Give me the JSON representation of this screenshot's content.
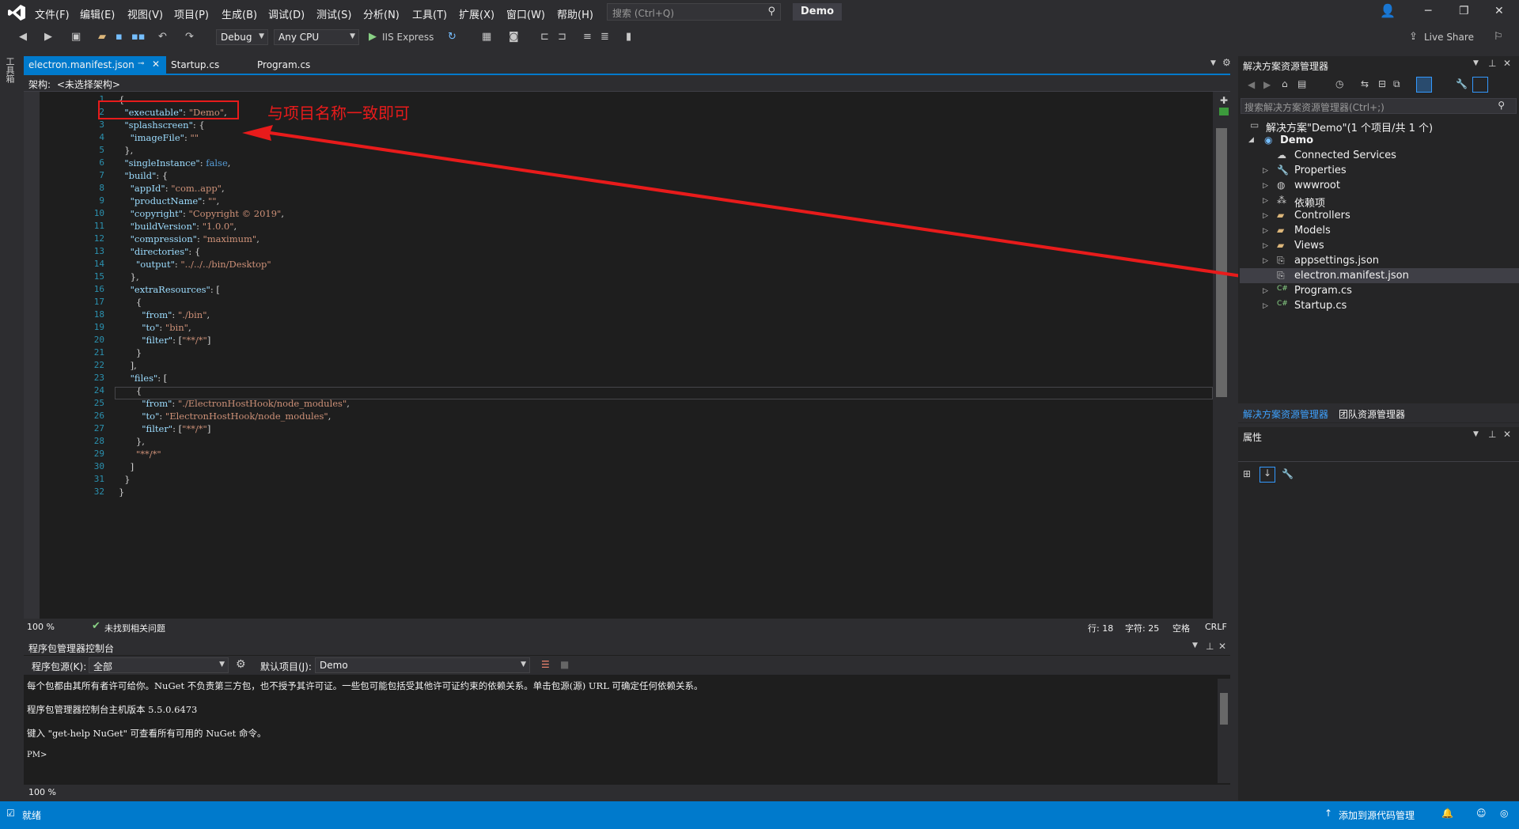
{
  "menu": [
    "文件(F)",
    "编辑(E)",
    "视图(V)",
    "项目(P)",
    "生成(B)",
    "调试(D)",
    "测试(S)",
    "分析(N)",
    "工具(T)",
    "扩展(X)",
    "窗口(W)",
    "帮助(H)"
  ],
  "search": {
    "placeholder": "搜索 (Ctrl+Q)"
  },
  "solution_name": "Demo",
  "toolbar": {
    "config": "Debug",
    "platform": "Any CPU",
    "run": "IIS Express",
    "live_share": "Live Share"
  },
  "toolbox_label": "工具箱",
  "tabs": [
    {
      "label": "electron.manifest.json",
      "active": true
    },
    {
      "label": "Startup.cs",
      "active": false
    },
    {
      "label": "Program.cs",
      "active": false
    }
  ],
  "nav": {
    "label": "架构:",
    "value": "<未选择架构>"
  },
  "code_lines": [
    "{",
    "  \"executable\": \"Demo\",",
    "  \"splashscreen\": {",
    "    \"imageFile\": \"\"",
    "  },",
    "  \"singleInstance\": false,",
    "  \"build\": {",
    "    \"appId\": \"com..app\",",
    "    \"productName\": \"\",",
    "    \"copyright\": \"Copyright © 2019\",",
    "    \"buildVersion\": \"1.0.0\",",
    "    \"compression\": \"maximum\",",
    "    \"directories\": {",
    "      \"output\": \"../../../bin/Desktop\"",
    "    },",
    "    \"extraResources\": [",
    "      {",
    "        \"from\": \"./bin\",",
    "        \"to\": \"bin\",",
    "        \"filter\": [\"**/*\"]",
    "      }",
    "    ],",
    "    \"files\": [",
    "      {",
    "        \"from\": \"./ElectronHostHook/node_modules\",",
    "        \"to\": \"ElectronHostHook/node_modules\",",
    "        \"filter\": [\"**/*\"]",
    "      },",
    "      \"**/*\"",
    "    ]",
    "  }",
    "}"
  ],
  "annotation": "与项目名称一致即可",
  "editor_status": {
    "zoom": "100 %",
    "issues": "未找到相关问题",
    "line": "行: 18",
    "char": "字符: 25",
    "space": "空格",
    "eol": "CRLF"
  },
  "solution_explorer": {
    "title": "解决方案资源管理器",
    "search_placeholder": "搜索解决方案资源管理器(Ctrl+;)",
    "solution_label": "解决方案\"Demo\"(1 个项目/共 1 个)",
    "project": "Demo",
    "items": [
      "Connected Services",
      "Properties",
      "wwwroot",
      "依赖项",
      "Controllers",
      "Models",
      "Views",
      "appsettings.json",
      "electron.manifest.json",
      "Program.cs",
      "Startup.cs"
    ],
    "bottom_tabs": [
      "解决方案资源管理器",
      "团队资源管理器"
    ]
  },
  "properties": {
    "title": "属性"
  },
  "pmc": {
    "title": "程序包管理器控制台",
    "source_label": "程序包源(K):",
    "source_value": "全部",
    "default_project_label": "默认项目(J):",
    "default_project_value": "Demo",
    "lines": [
      "每个包都由其所有者许可给你。NuGet 不负责第三方包，也不授予其许可证。一些包可能包括受其他许可证约束的依赖关系。单击包源(源) URL 可确定任何依赖关系。",
      "程序包管理器控制台主机版本 5.5.0.6473",
      "键入 \"get-help NuGet\" 可查看所有可用的 NuGet 命令。",
      "PM>"
    ],
    "zoom": "100 %"
  },
  "statusbar": {
    "ready": "就绪",
    "source_control": "添加到源代码管理"
  },
  "colors": {
    "accent": "#007acc",
    "annotation": "#e81b1b",
    "editor_bg": "#1e1e1e"
  }
}
